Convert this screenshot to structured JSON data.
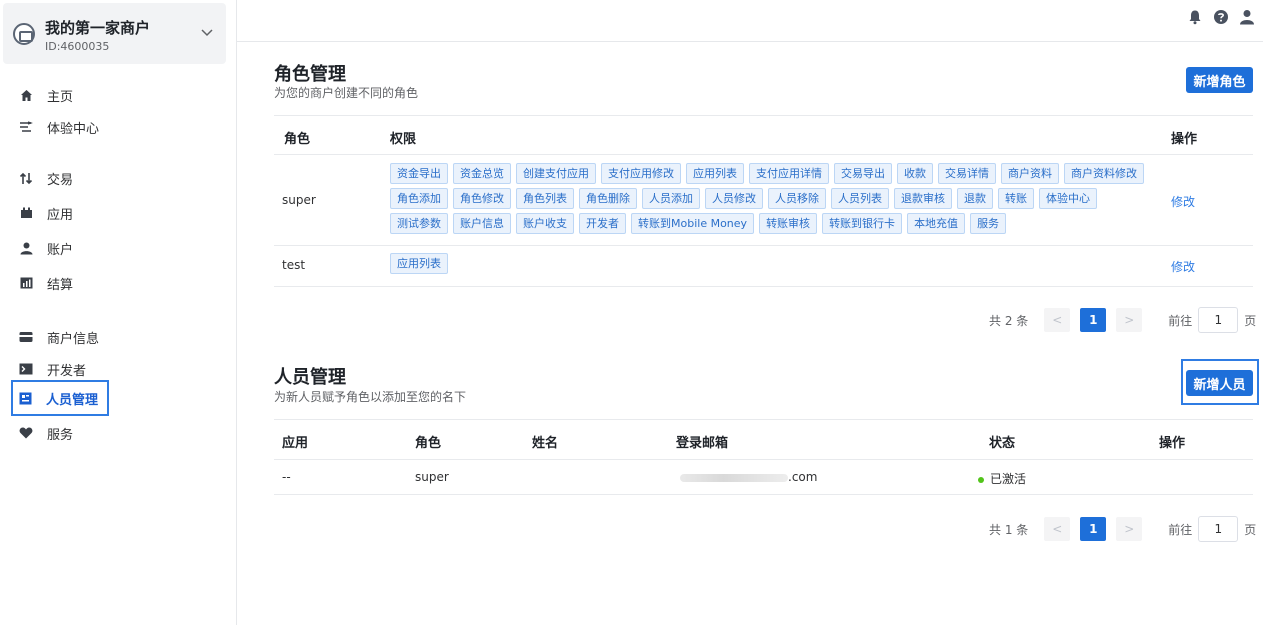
{
  "merchant": {
    "name": "我的第一家商户",
    "id": "ID:4600035"
  },
  "nav": [
    {
      "label": "主页",
      "icon": "home-icon"
    },
    {
      "label": "体验中心",
      "icon": "flask-icon"
    },
    {
      "label": "交易",
      "icon": "swap-icon"
    },
    {
      "label": "应用",
      "icon": "grid-icon"
    },
    {
      "label": "账户",
      "icon": "user-icon"
    },
    {
      "label": "结算",
      "icon": "chart-icon"
    },
    {
      "label": "商户信息",
      "icon": "store-icon"
    },
    {
      "label": "开发者",
      "icon": "terminal-icon"
    },
    {
      "label": "人员管理",
      "icon": "id-card-icon",
      "active": true
    },
    {
      "label": "服务",
      "icon": "heart-icon"
    }
  ],
  "roles": {
    "title": "角色管理",
    "subtitle": "为您的商户创建不同的角色",
    "add_button": "新增角色",
    "headers": {
      "role": "角色",
      "perm": "权限",
      "op": "操作"
    },
    "rows": [
      {
        "role": "super",
        "action": "修改",
        "perms": [
          "资金导出",
          "资金总览",
          "创建支付应用",
          "支付应用修改",
          "应用列表",
          "支付应用详情",
          "交易导出",
          "收款",
          "交易详情",
          "商户资料",
          "商户资料修改",
          "角色添加",
          "角色修改",
          "角色列表",
          "角色删除",
          "人员添加",
          "人员修改",
          "人员移除",
          "人员列表",
          "退款审核",
          "退款",
          "转账",
          "体验中心",
          "测试参数",
          "账户信息",
          "账户收支",
          "开发者",
          "转账到Mobile Money",
          "转账审核",
          "转账到银行卡",
          "本地充值",
          "服务"
        ]
      },
      {
        "role": "test",
        "action": "修改",
        "perms": [
          "应用列表"
        ]
      }
    ],
    "pager": {
      "total": "共 2 条",
      "prev": "<",
      "page": "1",
      "next": ">",
      "goto_label": "前往",
      "goto_value": "1",
      "goto_unit": "页"
    }
  },
  "staff": {
    "title": "人员管理",
    "subtitle": "为新人员赋予角色以添加至您的名下",
    "add_button": "新增人员",
    "headers": {
      "app": "应用",
      "role": "角色",
      "name": "姓名",
      "email": "登录邮箱",
      "status": "状态",
      "op": "操作"
    },
    "rows": [
      {
        "app": "--",
        "role": "super",
        "name": "",
        "email_suffix": ".com",
        "status": "已激活",
        "status_color": "#52c41a"
      }
    ],
    "pager": {
      "total": "共 1 条",
      "prev": "<",
      "page": "1",
      "next": ">",
      "goto_label": "前往",
      "goto_value": "1",
      "goto_unit": "页"
    }
  },
  "colors": {
    "primary": "#1e6fd9",
    "link": "#2f7ce3",
    "highlight": "#2f7ce3"
  }
}
